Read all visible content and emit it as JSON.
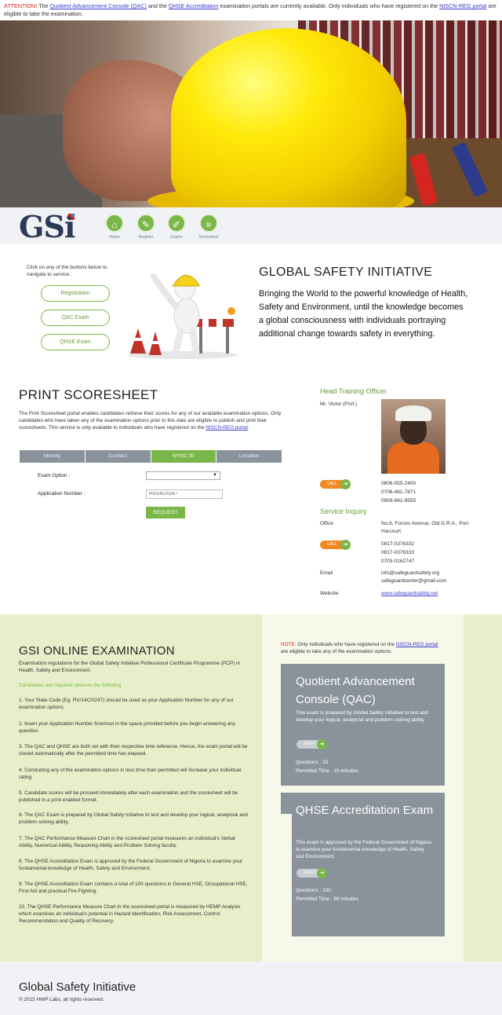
{
  "attention": {
    "label": "ATTENTION!",
    "text_1": " The ",
    "link_qac": "Quotient Advancement Console (QAC)",
    "text_2": " and the ",
    "link_qhse": "QHSE Accreditation",
    "text_3": " examination portals are currently available. Only individuals who have registered on the ",
    "link_niscn": "NISCN-REG portal",
    "text_4": " are eligible to take the examination."
  },
  "nav": {
    "logo": "GSi",
    "items": [
      {
        "label": "Home",
        "icon": "home-icon",
        "glyph": "⌂"
      },
      {
        "label": "Register",
        "icon": "register-icon",
        "glyph": "✎"
      },
      {
        "label": "Exams",
        "icon": "exams-icon",
        "glyph": "✐"
      },
      {
        "label": "Scoresheet",
        "icon": "scoresheet-icon",
        "glyph": "≡"
      }
    ]
  },
  "intro": {
    "hint": "Click on any of the buttons below to navigate to service :",
    "buttons": [
      "Registration",
      "QAC Exam",
      "QHSE Exam"
    ],
    "title": "GLOBAL SAFETY INITIATIVE",
    "tagline": "Bringing the World to the powerful knowledge of Health, Safety and Environment, until the knowledge becomes a global consciousness with individuals portraying additional change towards safety in everything."
  },
  "scoresheet": {
    "title": "PRINT SCORESHEET",
    "desc": "The Print Scoresheet portal enables candidates retrieve their scores for any of our available examination options. Only candidates who have taken any of the examination options prior to this date are eligible to publish and print their scoresheets. This service is only available to individuals who have registered on the ",
    "desc_link": "NISCN-REG portal",
    "desc_end": ".",
    "tabs": [
      "Identity",
      "Contact",
      "NYSC ID",
      "Location"
    ],
    "active_tab": "NYSC ID",
    "exam_option_label": "Exam Option :",
    "exam_option_value": "",
    "app_number_label": "Application Number :",
    "app_number_value": "RV/14C/0247",
    "request_label": "REQUEST"
  },
  "officer": {
    "heading": "Head Training Officer",
    "name": "Mr. Victor (Prof.)",
    "call_label": "CALL",
    "phones": [
      "0806-055-2400",
      "0706-481-7871",
      "0909-681-9555"
    ]
  },
  "inquiry": {
    "heading": "Service Inquiry",
    "office_label": "Office",
    "office_value": "No.6, Forces Avenue, Old G.R.A., Port Harcourt.",
    "call_label": "CALL",
    "phones": [
      "0817-0376332",
      "0817-0376333",
      "0703-0162747"
    ],
    "email_label": "Email",
    "emails": [
      "info@safeguardsafety.org",
      "safeguardcenter@gmail.com"
    ],
    "website_label": "Website",
    "website": "www.safeguardsafety.net"
  },
  "exam": {
    "title": "GSI ONLINE EXAMINATION",
    "intro": "Examination regulations for the Global Safety Initiative Professional Certificate Programme (PCP) in Health, Safety and Environment.",
    "note_green": "Candidates are required observe the following :",
    "rules": [
      "1. Your State Code (Eg. RV/14C/0247) should be used as your Application Number for any of our examination options.",
      "2. Insert your Application Number foremost in the space provided before you begin answering any question.",
      "3. The QAC and QHSE are both set with their respective time reference. Hence, the exam portal will be closed automatically after the permitted time has elapsed.",
      "4. Concluding any of the examination options in less time than permitted will increase your individual rating.",
      "5. Candidate scores will be proceed immediately after each examination and the scoresheet will be published in a print-enabled format.",
      "6. The QAC Exam is prepared by Global Safety Initiative to test and develop your logical, analytcial and problem solving ability.",
      "7. The QAC Performance Measure Chart in the scoresheet portal measures an individual's Verbal Ability, Numerical Ability, Reasoning Ability and Problem Solving faculty.",
      "8. The QHSE Accreditation Exam is approved by the Federal Government of Nigeria to examine your fundamental knowledge of Health, Safety and Environment.",
      "9. The QHSE Accreditation Exam contains a total of 100 questions in General HSE, Occupational HSE, First Aid and practical Fire Fighting.",
      "10. The QHSE Performance Measure Chart in the scoresheet portal is measured by HEMP Analysis which examines an individual's potential in Hazard Identification, Risk Assessment, Control Recommendation and Quality of Recovery."
    ],
    "note_label": "NOTE:",
    "note_text": " Only individuals who have registered on the ",
    "note_link": "NISCN-REG portal",
    "note_end": " are eligible to take any of the examination options.",
    "cards": [
      {
        "title": "Quotient Advancement Console (QAC)",
        "desc": "This exam is prepared by Global Safety Initiative to test and develop your logical, analytcial and problem solving ability.",
        "start_label": "START",
        "questions": "Questions : 15",
        "time": "Permitted Time : 10 minutes."
      },
      {
        "title": "QHSE Accreditation Exam",
        "desc": "This exam is approved by the Federal Government of Nigeria to examine your fundamental knowledge of Health, Safety and Environment.",
        "start_label": "START",
        "questions": "Questions : 100",
        "time": "Permitted Time : 60 minutes."
      }
    ]
  },
  "footer": {
    "title": "Global Safety Initiative",
    "copy": "© 2015 HWP Labs, all rights reserved."
  },
  "colors": {
    "accent_green": "#7ab648",
    "alert_red": "#d0261f",
    "call_orange": "#f08a24",
    "card_gray": "#8a939b"
  }
}
